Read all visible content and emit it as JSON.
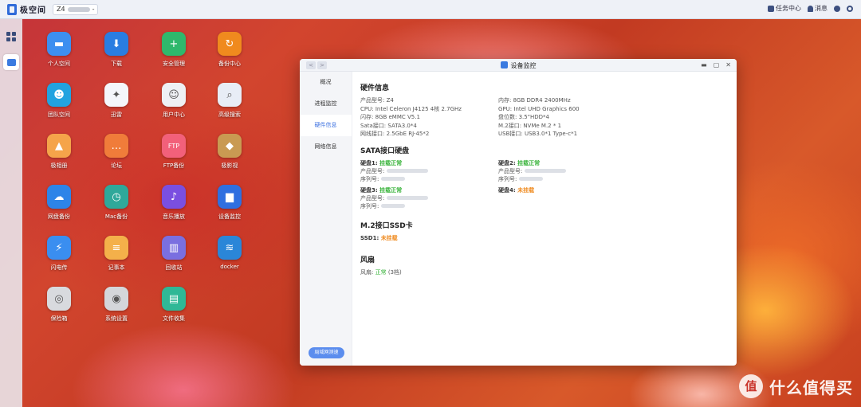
{
  "topbar": {
    "app_name": "极空间",
    "device_prefix": "Z4",
    "device_suffix": "-",
    "task_center": "任务中心",
    "messages": "消息"
  },
  "dock": [
    {
      "icon": "apps-grid-icon"
    },
    {
      "icon": "device-monitor-icon"
    }
  ],
  "desktop": {
    "apps": [
      {
        "label": "个人空间",
        "icon": "folder-icon",
        "color": "#3d8ff0",
        "glyph": "▬"
      },
      {
        "label": "下载",
        "icon": "download-globe-icon",
        "color": "#2a7de1",
        "glyph": "⬇"
      },
      {
        "label": "安全管理",
        "icon": "shield-icon",
        "color": "#2fb86c",
        "glyph": "+"
      },
      {
        "label": "备份中心",
        "icon": "backup-icon",
        "color": "#f08a1e",
        "glyph": "↻"
      },
      {
        "label": "团队空间",
        "icon": "team-folder-icon",
        "color": "#22a3e0",
        "glyph": "☻"
      },
      {
        "label": "迅雷",
        "icon": "xunlei-icon",
        "color": "#f4f6fb",
        "glyph": "✦"
      },
      {
        "label": "用户中心",
        "icon": "user-center-icon",
        "color": "#eef0f4",
        "glyph": "☺"
      },
      {
        "label": "高级搜索",
        "icon": "search-icon",
        "color": "#e8edf6",
        "glyph": "⌕"
      },
      {
        "label": "极相册",
        "icon": "photo-album-icon",
        "color": "#f5a44a",
        "glyph": "▲"
      },
      {
        "label": "论坛",
        "icon": "forum-icon",
        "color": "#f07c3a",
        "glyph": "…"
      },
      {
        "label": "FTP备份",
        "icon": "ftp-icon",
        "color": "#f2607a",
        "glyph": "FTP"
      },
      {
        "label": "极影视",
        "icon": "video-icon",
        "color": "#c99a52",
        "glyph": "◆"
      },
      {
        "label": "网盘备份",
        "icon": "cloud-backup-icon",
        "color": "#2d84e8",
        "glyph": "☁"
      },
      {
        "label": "Mac备份",
        "icon": "mac-backup-icon",
        "color": "#2fa89a",
        "glyph": "◷"
      },
      {
        "label": "音乐播放",
        "icon": "music-icon",
        "color": "#7a4fe0",
        "glyph": "♪"
      },
      {
        "label": "设备监控",
        "icon": "monitor-icon",
        "color": "#2f6fe0",
        "glyph": "▆"
      },
      {
        "label": "闪电传",
        "icon": "lightning-icon",
        "color": "#3a8ef0",
        "glyph": "⚡"
      },
      {
        "label": "记事本",
        "icon": "notepad-icon",
        "color": "#f4b04a",
        "glyph": "≡"
      },
      {
        "label": "回收站",
        "icon": "trash-icon",
        "color": "#7a6fe0",
        "glyph": "▥"
      },
      {
        "label": "docker",
        "icon": "docker-icon",
        "color": "#2a86d8",
        "glyph": "≋"
      },
      {
        "label": "保险箱",
        "icon": "safe-icon",
        "color": "#d8dade",
        "glyph": "◎"
      },
      {
        "label": "系统设置",
        "icon": "settings-icon",
        "color": "#d4d6da",
        "glyph": "◉"
      },
      {
        "label": "文件收集",
        "icon": "file-collect-icon",
        "color": "#2fb896",
        "glyph": "▤"
      }
    ]
  },
  "window": {
    "title": "设备监控",
    "nav": [
      "概况",
      "进程监控",
      "硬件信息",
      "网络信息"
    ],
    "active_nav": 2,
    "footer_button": "局域网测速",
    "hardware": {
      "heading": "硬件信息",
      "left": [
        {
          "k": "产品型号:",
          "v": "Z4"
        },
        {
          "k": "CPU:",
          "v": "Intel Celeron J4125 4核 2.7GHz"
        },
        {
          "k": "闪存:",
          "v": "8GB eMMC V5.1"
        },
        {
          "k": "Sata接口:",
          "v": "SATA3.0*4"
        },
        {
          "k": "网线接口:",
          "v": "2.5GbE RJ-45*2"
        }
      ],
      "right": [
        {
          "k": "内存:",
          "v": "8GB DDR4 2400MHz"
        },
        {
          "k": "GPU:",
          "v": "Intel UHD Graphics 600"
        },
        {
          "k": "盘位数:",
          "v": "3.5\"HDD*4"
        },
        {
          "k": "M.2接口:",
          "v": "NVMe M.2 * 1"
        },
        {
          "k": "USB接口:",
          "v": "USB3.0*1 Type-c*1"
        }
      ]
    },
    "sata": {
      "heading": "SATA接口硬盘",
      "model_label": "产品型号:",
      "serial_label": "序列号:",
      "disks": [
        {
          "name": "硬盘1:",
          "status": "挂载正常",
          "state": "ok"
        },
        {
          "name": "硬盘2:",
          "status": "挂载正常",
          "state": "ok"
        },
        {
          "name": "硬盘3:",
          "status": "挂载正常",
          "state": "ok"
        },
        {
          "name": "硬盘4:",
          "status": "未挂载",
          "state": "warn"
        }
      ]
    },
    "m2": {
      "heading": "M.2接口SSD卡",
      "name": "SSD1:",
      "status": "未挂载"
    },
    "fan": {
      "heading": "风扇",
      "label": "风扇:",
      "status": "正常",
      "level": "(3档)"
    }
  },
  "watermark": {
    "mark": "值",
    "text": "什么值得买"
  },
  "colors": {
    "accent": "#3a6fe0",
    "ok": "#35b237",
    "warn": "#ef8a1e"
  }
}
